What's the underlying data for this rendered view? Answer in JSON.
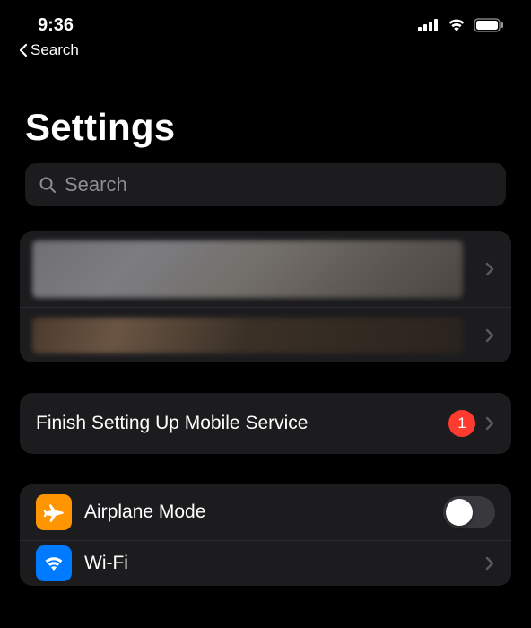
{
  "status": {
    "time": "9:36"
  },
  "backNav": {
    "label": "Search"
  },
  "pageTitle": "Settings",
  "search": {
    "placeholder": "Search"
  },
  "accountGroup": {
    "items": [
      {
        "kind": "redacted-large"
      },
      {
        "kind": "redacted-small"
      }
    ]
  },
  "setupGroup": {
    "label": "Finish Setting Up Mobile Service",
    "badge": "1"
  },
  "settingsGroup": {
    "items": [
      {
        "icon": "airplane",
        "label": "Airplane Mode",
        "control": "switch",
        "switchOn": false
      },
      {
        "icon": "wifi",
        "label": "Wi-Fi",
        "control": "disclosure"
      }
    ]
  }
}
